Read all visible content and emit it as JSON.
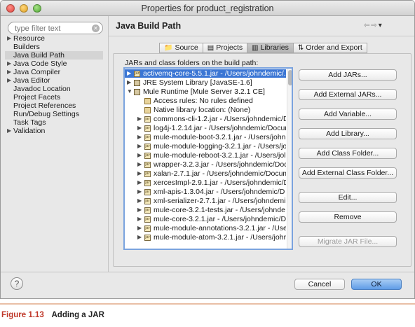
{
  "window": {
    "title": "Properties for product_registration"
  },
  "filter": {
    "placeholder": "type filter text",
    "clear_icon": "clear-icon"
  },
  "nav": {
    "items": [
      {
        "label": "Resource",
        "arrow": true,
        "selected": false
      },
      {
        "label": "Builders",
        "arrow": false,
        "selected": false
      },
      {
        "label": "Java Build Path",
        "arrow": false,
        "selected": true
      },
      {
        "label": "Java Code Style",
        "arrow": true,
        "selected": false
      },
      {
        "label": "Java Compiler",
        "arrow": true,
        "selected": false
      },
      {
        "label": "Java Editor",
        "arrow": true,
        "selected": false
      },
      {
        "label": "Javadoc Location",
        "arrow": false,
        "selected": false
      },
      {
        "label": "Project Facets",
        "arrow": false,
        "selected": false
      },
      {
        "label": "Project References",
        "arrow": false,
        "selected": false
      },
      {
        "label": "Run/Debug Settings",
        "arrow": false,
        "selected": false
      },
      {
        "label": "Task Tags",
        "arrow": false,
        "selected": false
      },
      {
        "label": "Validation",
        "arrow": true,
        "selected": false
      }
    ]
  },
  "main": {
    "title": "Java Build Path",
    "tabs": [
      {
        "label": "Source",
        "icon": "source-folder-icon",
        "active": false
      },
      {
        "label": "Projects",
        "icon": "projects-icon",
        "active": false
      },
      {
        "label": "Libraries",
        "icon": "libraries-icon",
        "active": true
      },
      {
        "label": "Order and Export",
        "icon": "order-export-icon",
        "active": false
      }
    ],
    "list_label": "JARs and class folders on the build path:",
    "tree": [
      {
        "text": "activemq-core-5.5.1.jar - /Users/johndemic/.",
        "level": 0,
        "twisty": "closed",
        "icon": "jar",
        "selected": true
      },
      {
        "text": "JRE System Library [JavaSE-1.6]",
        "level": 0,
        "twisty": "closed",
        "icon": "lib",
        "selected": false
      },
      {
        "text": "Mule Runtime [Mule Server 3.2.1 CE]",
        "level": 0,
        "twisty": "open",
        "icon": "lib",
        "selected": false
      },
      {
        "text": "Access rules: No rules defined",
        "level": 1,
        "twisty": "none",
        "icon": "rule",
        "selected": false
      },
      {
        "text": "Native library location: (None)",
        "level": 1,
        "twisty": "none",
        "icon": "rule",
        "selected": false
      },
      {
        "text": "commons-cli-1.2.jar - /Users/johndemic/D",
        "level": 1,
        "twisty": "closed",
        "icon": "jar",
        "selected": false
      },
      {
        "text": "log4j-1.2.14.jar - /Users/johndemic/Docum",
        "level": 1,
        "twisty": "closed",
        "icon": "jar",
        "selected": false
      },
      {
        "text": "mule-module-boot-3.2.1.jar - /Users/john",
        "level": 1,
        "twisty": "closed",
        "icon": "jar",
        "selected": false
      },
      {
        "text": "mule-module-logging-3.2.1.jar - /Users/jo",
        "level": 1,
        "twisty": "closed",
        "icon": "jar",
        "selected": false
      },
      {
        "text": "mule-module-reboot-3.2.1.jar - /Users/jol",
        "level": 1,
        "twisty": "closed",
        "icon": "jar",
        "selected": false
      },
      {
        "text": "wrapper-3.2.3.jar - /Users/johndemic/Doc",
        "level": 1,
        "twisty": "closed",
        "icon": "jar",
        "selected": false
      },
      {
        "text": "xalan-2.7.1.jar - /Users/johndemic/Docum",
        "level": 1,
        "twisty": "closed",
        "icon": "jar",
        "selected": false
      },
      {
        "text": "xercesImpl-2.9.1.jar - /Users/johndemic/D",
        "level": 1,
        "twisty": "closed",
        "icon": "jar",
        "selected": false
      },
      {
        "text": "xml-apis-1.3.04.jar - /Users/johndemic/D",
        "level": 1,
        "twisty": "closed",
        "icon": "jar",
        "selected": false
      },
      {
        "text": "xml-serializer-2.7.1.jar - /Users/johndemi",
        "level": 1,
        "twisty": "closed",
        "icon": "jar",
        "selected": false
      },
      {
        "text": "mule-core-3.2.1-tests.jar - /Users/johnde",
        "level": 1,
        "twisty": "closed",
        "icon": "jar",
        "selected": false
      },
      {
        "text": "mule-core-3.2.1.jar - /Users/johndemic/D",
        "level": 1,
        "twisty": "closed",
        "icon": "jar",
        "selected": false
      },
      {
        "text": "mule-module-annotations-3.2.1.jar - /Use",
        "level": 1,
        "twisty": "closed",
        "icon": "jar",
        "selected": false
      },
      {
        "text": "mule-module-atom-3.2.1.jar - /Users/johr",
        "level": 1,
        "twisty": "closed",
        "icon": "jar",
        "selected": false
      }
    ],
    "buttons": [
      {
        "label": "Add JARs...",
        "name": "add-jars-button",
        "enabled": true
      },
      {
        "label": "Add External JARs...",
        "name": "add-external-jars-button",
        "enabled": true
      },
      {
        "label": "Add Variable...",
        "name": "add-variable-button",
        "enabled": true
      },
      {
        "label": "Add Library...",
        "name": "add-library-button",
        "enabled": true
      },
      {
        "label": "Add Class Folder...",
        "name": "add-class-folder-button",
        "enabled": true
      },
      {
        "label": "Add External Class Folder...",
        "name": "add-external-class-folder-button",
        "enabled": true
      },
      {
        "label": "Edit...",
        "name": "edit-button",
        "enabled": true
      },
      {
        "label": "Remove",
        "name": "remove-button",
        "enabled": true
      },
      {
        "label": "Migrate JAR File...",
        "name": "migrate-jar-button",
        "enabled": false
      }
    ]
  },
  "footer": {
    "help": "?",
    "cancel": "Cancel",
    "ok": "OK"
  },
  "caption": {
    "number": "Figure 1.13",
    "text": "Adding a JAR"
  },
  "colors": {
    "selection": "#3b76d4",
    "ok_button": "#5f9ce7",
    "caption_number": "#c0392b"
  }
}
